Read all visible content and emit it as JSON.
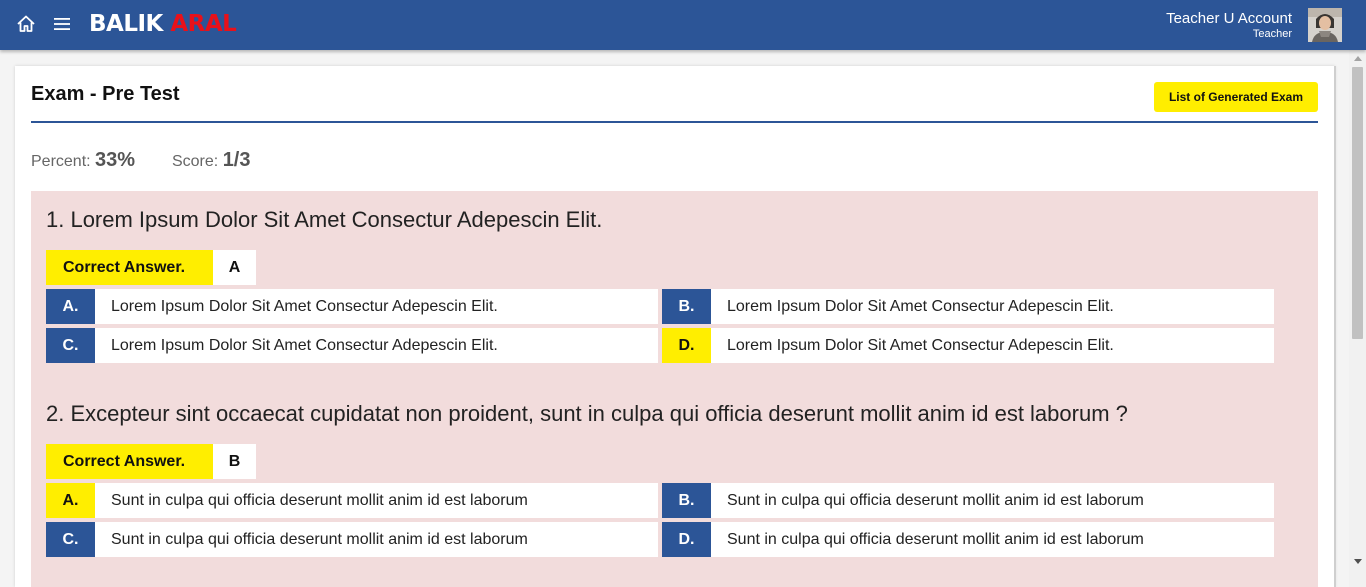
{
  "header": {
    "brand_part1": "BALIK ",
    "brand_part2": "ARAL",
    "user_name": "Teacher U Account",
    "user_role": "Teacher",
    "home_icon": "home-icon",
    "menu_icon": "hamburger-menu-icon",
    "bar_color": "#2c5597",
    "brand_accent": "#e8111a"
  },
  "exam": {
    "title": "Exam - Pre Test",
    "list_button": "List of Generated Exam",
    "percent_label": "Percent:",
    "percent_value": "33%",
    "score_label": "Score:",
    "score_value": "1/3"
  },
  "questions": [
    {
      "text": "1. Lorem Ipsum Dolor Sit Amet Consectur Adepescin Elit.",
      "correct_label": "Correct Answer.",
      "correct_value": "A",
      "options": [
        {
          "letter": "A.",
          "text": "Lorem Ipsum Dolor Sit Amet Consectur Adepescin Elit.",
          "highlighted": false
        },
        {
          "letter": "B.",
          "text": "Lorem Ipsum Dolor Sit Amet Consectur Adepescin Elit.",
          "highlighted": false
        },
        {
          "letter": "C.",
          "text": "Lorem Ipsum Dolor Sit Amet Consectur Adepescin Elit.",
          "highlighted": false
        },
        {
          "letter": "D.",
          "text": "Lorem Ipsum Dolor Sit Amet Consectur Adepescin Elit.",
          "highlighted": true
        }
      ]
    },
    {
      "text": "2. Excepteur sint occaecat cupidatat non proident, sunt in culpa qui officia deserunt mollit anim id est laborum ?",
      "correct_label": "Correct Answer.",
      "correct_value": "B",
      "options": [
        {
          "letter": "A.",
          "text": "Sunt in culpa qui officia deserunt mollit anim id est laborum",
          "highlighted": true
        },
        {
          "letter": "B.",
          "text": "Sunt in culpa qui officia deserunt mollit anim id est laborum",
          "highlighted": false
        },
        {
          "letter": "C.",
          "text": "Sunt in culpa qui officia deserunt mollit anim id est laborum",
          "highlighted": false
        },
        {
          "letter": "D.",
          "text": "Sunt in culpa qui officia deserunt mollit anim id est laborum",
          "highlighted": false
        }
      ]
    }
  ],
  "colors": {
    "primary": "#2c5597",
    "highlight": "#ffee00",
    "quiz_background": "#f2dcdc"
  }
}
